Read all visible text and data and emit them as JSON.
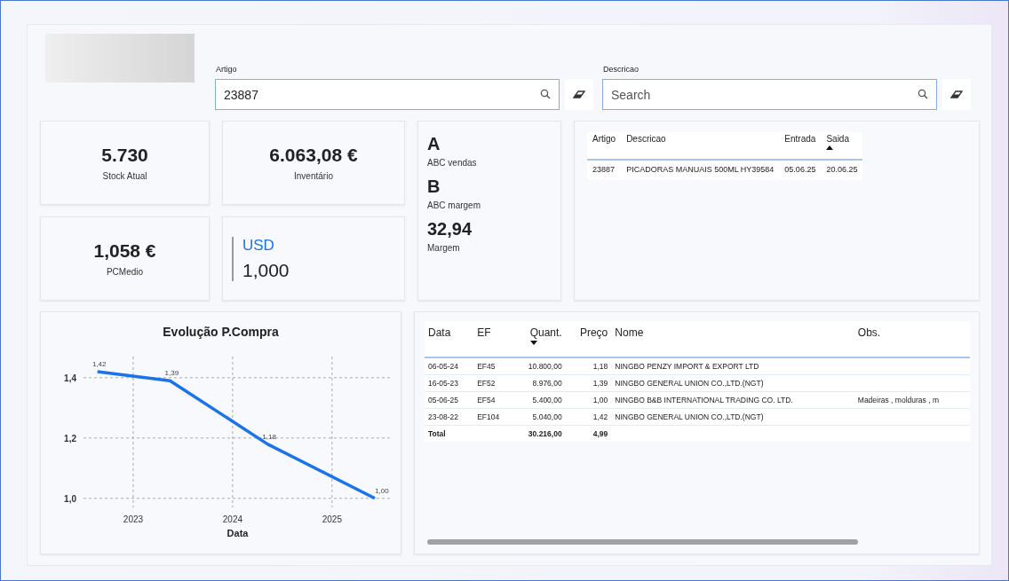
{
  "search": {
    "artigo": {
      "label": "Artigo",
      "value": "23887"
    },
    "descricao": {
      "label": "Descricao",
      "placeholder": "Search"
    }
  },
  "kpis": [
    {
      "value": "5.730",
      "label": "Stock Atual"
    },
    {
      "value": "6.063,08 €",
      "label": "Inventário"
    },
    {
      "value": "1,058 €",
      "label": "PCMedio"
    }
  ],
  "currency": {
    "code": "USD",
    "rate": "1,000"
  },
  "abc": [
    {
      "value": "A",
      "label": "ABC vendas"
    },
    {
      "value": "B",
      "label": "ABC margem"
    },
    {
      "value": "32,94",
      "label": "Margem"
    }
  ],
  "article_table": {
    "columns": [
      {
        "label": "Artigo",
        "sorted": false
      },
      {
        "label": "Descricao",
        "sorted": false
      },
      {
        "label": "Entrada",
        "sorted": false
      },
      {
        "label": "Saida",
        "sorted": true,
        "ascending": true
      }
    ],
    "rows": [
      [
        "23887",
        "PICADORAS MANUAIS 500ML HY39584",
        "05.06.25",
        "20.06.25"
      ]
    ]
  },
  "chart": {
    "chart_data": {
      "type": "line",
      "title": "Evolução P.Compra",
      "xlabel": "Data",
      "x": [
        2022.64,
        2023.37,
        2024.35,
        2025.43
      ],
      "series": [
        {
          "color": "#1a73e8",
          "values": [
            1.42,
            1.39,
            1.18,
            1.0
          ]
        }
      ],
      "value_labels": [
        "1,42",
        "1,39",
        "1,18",
        "1,00"
      ],
      "grid": true,
      "xlim": [
        2022.5,
        2025.6
      ],
      "ylim": [
        0.97,
        1.47
      ],
      "xticks": [
        {
          "value": 2023,
          "label": "2023"
        },
        {
          "value": 2024,
          "label": "2024"
        },
        {
          "value": 2025,
          "label": "2025"
        }
      ],
      "yticks": [
        {
          "value": 1.0,
          "label": "1,0"
        },
        {
          "value": 1.2,
          "label": "1,2"
        },
        {
          "value": 1.4,
          "label": "1,4"
        }
      ]
    }
  },
  "purchases_table": {
    "columns": [
      {
        "label": "Data",
        "sorted": false
      },
      {
        "label": "EF",
        "sorted": false
      },
      {
        "label": "Quant.",
        "sorted": true,
        "ascending": false
      },
      {
        "label": "Preço",
        "sorted": false
      },
      {
        "label": "Nome",
        "sorted": false
      },
      {
        "label": "Obs.",
        "sorted": false
      }
    ],
    "rows": [
      [
        "06-05-24",
        "EF45",
        "10.800,00",
        "1,18",
        "NINGBO PENZY IMPORT & EXPORT LTD",
        ""
      ],
      [
        "16-05-23",
        "EF52",
        "8.976,00",
        "1,39",
        "NINGBO GENERAL UNION CO.,LTD.(NGT)",
        ""
      ],
      [
        "05-06-25",
        "EF54",
        "5.400,00",
        "1,00",
        "NINGBO B&B INTERNATIONAL TRADING CO. LTD.",
        "Madeiras , molduras , m"
      ],
      [
        "23-08-22",
        "EF104",
        "5.040,00",
        "1,42",
        "NINGBO GENERAL UNION CO.,LTD.(NGT)",
        ""
      ]
    ],
    "total": {
      "label": "Total",
      "quantity": "30.216,00",
      "price": "4,99"
    }
  }
}
